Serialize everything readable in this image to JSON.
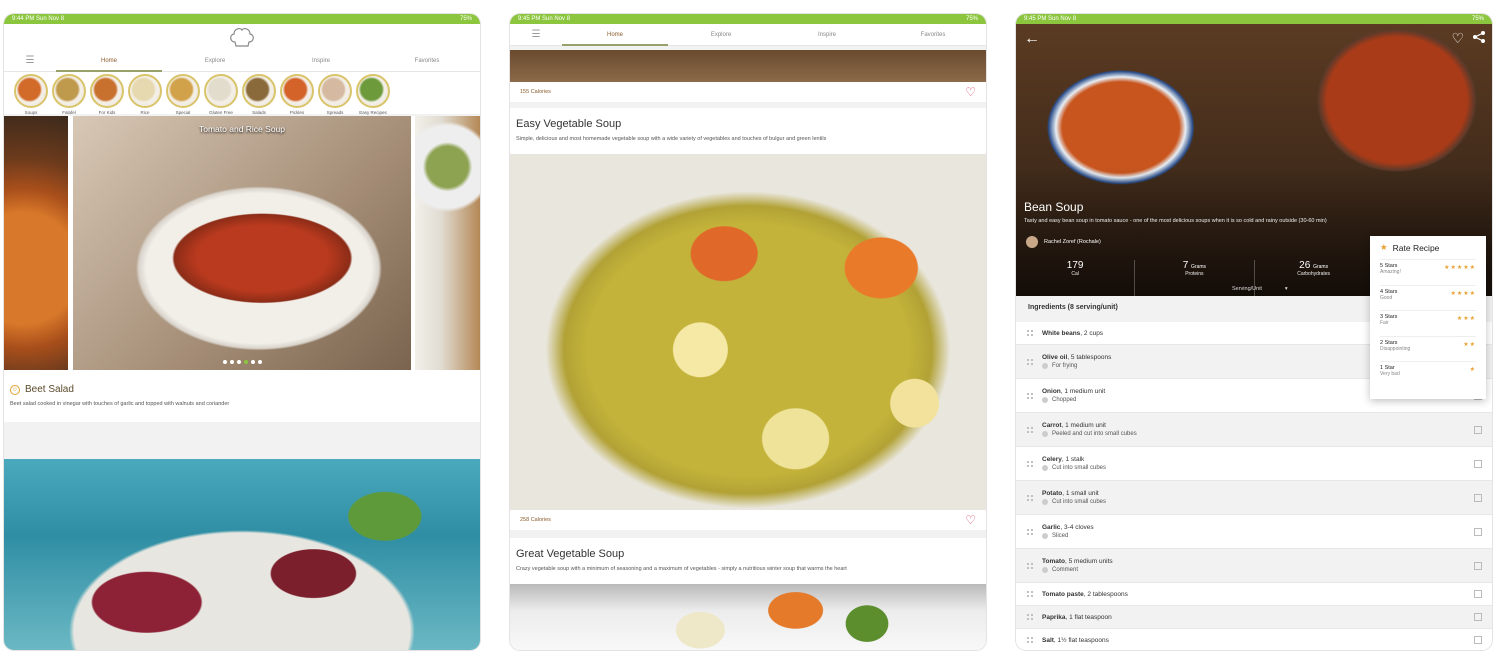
{
  "status": {
    "p1": {
      "time": "9:44 PM  Sun Nov 8",
      "battery": "75%"
    },
    "p2": {
      "time": "9:45 PM  Sun Nov 8",
      "battery": "75%"
    },
    "p3": {
      "time": "9:45 PM  Sun Nov 8",
      "battery": "75%"
    }
  },
  "tabs": [
    "Home",
    "Explore",
    "Inspire",
    "Favorites"
  ],
  "categories": [
    "Soups",
    "Falafel",
    "For Kids",
    "Rice",
    "Special",
    "Gluten Free",
    "Salads",
    "Pickles",
    "Spreads",
    "Easy Recipes"
  ],
  "home": {
    "carousel_title": "Tomato and Rice Soup",
    "carousel_pages": 6,
    "carousel_active": 4,
    "featured_title": "Beet Salad",
    "featured_desc": "Beet salad cooked in vinegar with touches of garlic and topped with walnuts and coriander"
  },
  "feed": {
    "card0_calories": "155 Calories",
    "card1_title": "Easy Vegetable Soup",
    "card1_desc": "Simple, delicious and most homemade vegetable soup with a wide variety of vegetables and touches of bulgur and green lentils",
    "card1_calories": "258 Calories",
    "card2_title": "Great Vegetable Soup",
    "card2_desc": "Crazy vegetable soup with a minimum of seasoning and a maximum of vegetables - simply a nutritious winter soup that warms the heart"
  },
  "recipe": {
    "title": "Bean Soup",
    "desc": "Tasty and easy bean soup in tomato sauce - one of the most delicious soups when it is so cold and rainy outside (30-60 min)",
    "author": "Rachel Zoref (Rochale)",
    "nutrition": [
      {
        "value": "179",
        "label": "Cal",
        "unit": ""
      },
      {
        "value": "7",
        "label": "Proteins",
        "unit": "Grams"
      },
      {
        "value": "26",
        "label": "Carbohydrates",
        "unit": "Grams"
      }
    ],
    "serving_label": "Serving/Unit",
    "ingredients_header": "Ingredients (8 serving/unit)",
    "ingredients": [
      {
        "name": "White beans",
        "qty": ", 2 cups",
        "note": ""
      },
      {
        "name": "Olive oil",
        "qty": ", 5 tablespoons",
        "note": "For frying"
      },
      {
        "name": "Onion",
        "qty": ", 1 medium unit",
        "note": "Chopped"
      },
      {
        "name": "Carrot",
        "qty": ", 1 medium unit",
        "note": "Peeled and cut into small cubes"
      },
      {
        "name": "Celery",
        "qty": ", 1 stalk",
        "note": "Cut into small cubes"
      },
      {
        "name": "Potato",
        "qty": ", 1 small unit",
        "note": "Cut into small cubes"
      },
      {
        "name": "Garlic",
        "qty": ", 3-4 cloves",
        "note": "Sliced"
      },
      {
        "name": "Tomato",
        "qty": ", 5 medium units",
        "note": "Comment"
      },
      {
        "name": "Tomato paste",
        "qty": ", 2 tablespoons",
        "note": ""
      },
      {
        "name": "Paprika",
        "qty": ", 1 flat teaspoon",
        "note": ""
      },
      {
        "name": "Salt",
        "qty": ", 1½ flat teaspoons",
        "note": ""
      }
    ],
    "rate": {
      "title": "Rate Recipe",
      "options": [
        {
          "label": "5 Stars",
          "desc": "Amazing!",
          "stars": "★★★★★"
        },
        {
          "label": "4 Stars",
          "desc": "Good",
          "stars": "★★★★"
        },
        {
          "label": "3 Stars",
          "desc": "Fair",
          "stars": "★★★"
        },
        {
          "label": "2 Stars",
          "desc": "Disappointing",
          "stars": "★★"
        },
        {
          "label": "1 Star",
          "desc": "Very bad",
          "stars": "★"
        }
      ]
    }
  },
  "colors": {
    "status_green": "#8cc63f",
    "brand_brown": "#8a5a2b",
    "heart": "#e0506b",
    "star": "#e8a030"
  }
}
